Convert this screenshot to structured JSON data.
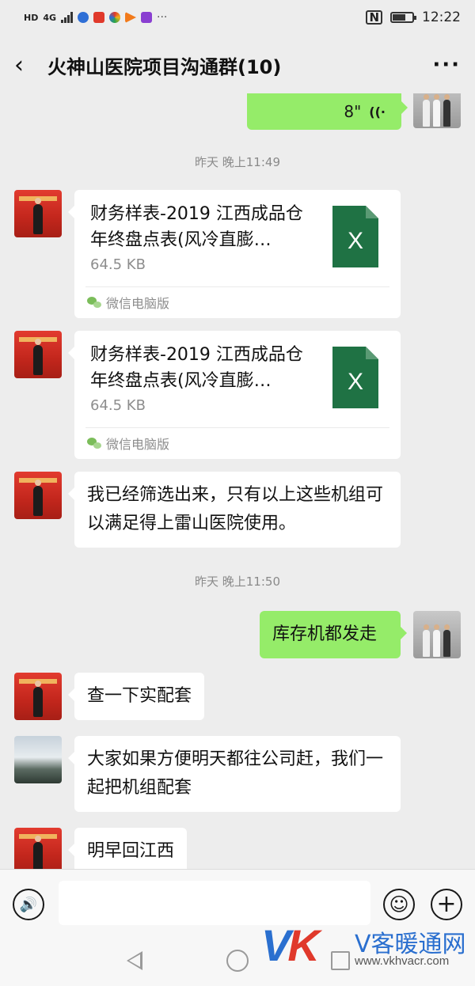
{
  "status_bar": {
    "left_tags": [
      "HD",
      "4G"
    ],
    "nfc": "N",
    "battery_level": 0.6,
    "time": "12:22"
  },
  "header": {
    "back_icon": "‹",
    "title": "火神山医院项目沟通群(10)",
    "more_icon": "···"
  },
  "messages": {
    "voice": {
      "duration": "8\"",
      "icon": "((·"
    },
    "time1": "昨天 晚上11:49",
    "file1": {
      "name": "财务样表-2019 江西成品仓年终盘点表(风冷直膨…",
      "size": "64.5 KB",
      "source": "微信电脑版",
      "icon_letter": "X"
    },
    "file2": {
      "name": "财务样表-2019 江西成品仓年终盘点表(风冷直膨…",
      "size": "64.5 KB",
      "source": "微信电脑版",
      "icon_letter": "X"
    },
    "text1": "我已经筛选出来，只有以上这些机组可以满足得上雷山医院使用。",
    "time2": "昨天 晚上11:50",
    "text2": "库存机都发走",
    "text3": "查一下实配套",
    "text4": "大家如果方便明天都往公司赶，我们一起把机组配套",
    "text5": "明早回江西"
  },
  "input_bar": {
    "voice_icon": "🔊",
    "emoji_icon": "☺",
    "plus_icon": "+"
  },
  "watermark": {
    "logo_v": "V",
    "logo_k": "K",
    "cn": "V客暖通网",
    "url": "www.vkhvacr.com"
  },
  "colors": {
    "background": "#ededed",
    "bubble_sent": "#95ec69",
    "bubble_received": "#ffffff",
    "excel_green": "#1f7244"
  }
}
